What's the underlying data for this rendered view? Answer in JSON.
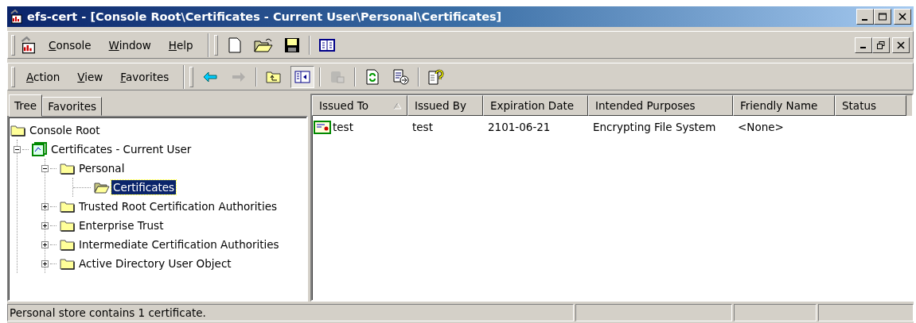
{
  "window": {
    "title": "efs-cert - [Console Root\\Certificates - Current User\\Personal\\Certificates]"
  },
  "menu_bar": [
    "Console",
    "Window",
    "Help"
  ],
  "action_bar": [
    "Action",
    "View",
    "Favorites"
  ],
  "toolbar": [
    {
      "kind": "back",
      "disabled": false,
      "pressed": false
    },
    {
      "kind": "forward",
      "disabled": true,
      "pressed": false
    },
    {
      "kind": "up",
      "disabled": false,
      "pressed": false
    },
    {
      "kind": "tree",
      "disabled": false,
      "pressed": true
    },
    {
      "kind": "delete",
      "disabled": true,
      "pressed": false
    },
    {
      "kind": "refresh",
      "disabled": false,
      "pressed": false
    },
    {
      "kind": "export",
      "disabled": false,
      "pressed": false
    },
    {
      "kind": "help",
      "disabled": false,
      "pressed": false
    }
  ],
  "tabs": [
    {
      "label": "Tree",
      "selected": true
    },
    {
      "label": "Favorites",
      "selected": false
    }
  ],
  "tree": [
    {
      "label": "Console Root",
      "selected": false,
      "children": [
        {
          "label": "Certificates - Current User",
          "kind": "snapin",
          "expanded": true,
          "selected": false,
          "children": [
            {
              "label": "Personal",
              "expanded": true,
              "selected": false,
              "children": [
                {
                  "label": "Certificates",
                  "selected": true
                }
              ]
            },
            {
              "label": "Trusted Root Certification Authorities",
              "expanded": false,
              "selected": false
            },
            {
              "label": "Enterprise Trust",
              "expanded": false,
              "selected": false
            },
            {
              "label": "Intermediate Certification Authorities",
              "expanded": false,
              "selected": false
            },
            {
              "label": "Active Directory User Object",
              "expanded": false,
              "selected": false
            }
          ]
        }
      ]
    }
  ],
  "table": {
    "columns": [
      {
        "label": "Issued To",
        "sorted": true
      },
      {
        "label": "Issued By",
        "sorted": false
      },
      {
        "label": "Expiration Date",
        "sorted": false
      },
      {
        "label": "Intended Purposes",
        "sorted": false
      },
      {
        "label": "Friendly Name",
        "sorted": false
      },
      {
        "label": "Status",
        "sorted": false
      }
    ],
    "rows": [
      [
        "test",
        "test",
        "2101-06-21",
        "Encrypting File System",
        "<None>"
      ]
    ]
  },
  "status_bar": "Personal store contains 1 certificate."
}
